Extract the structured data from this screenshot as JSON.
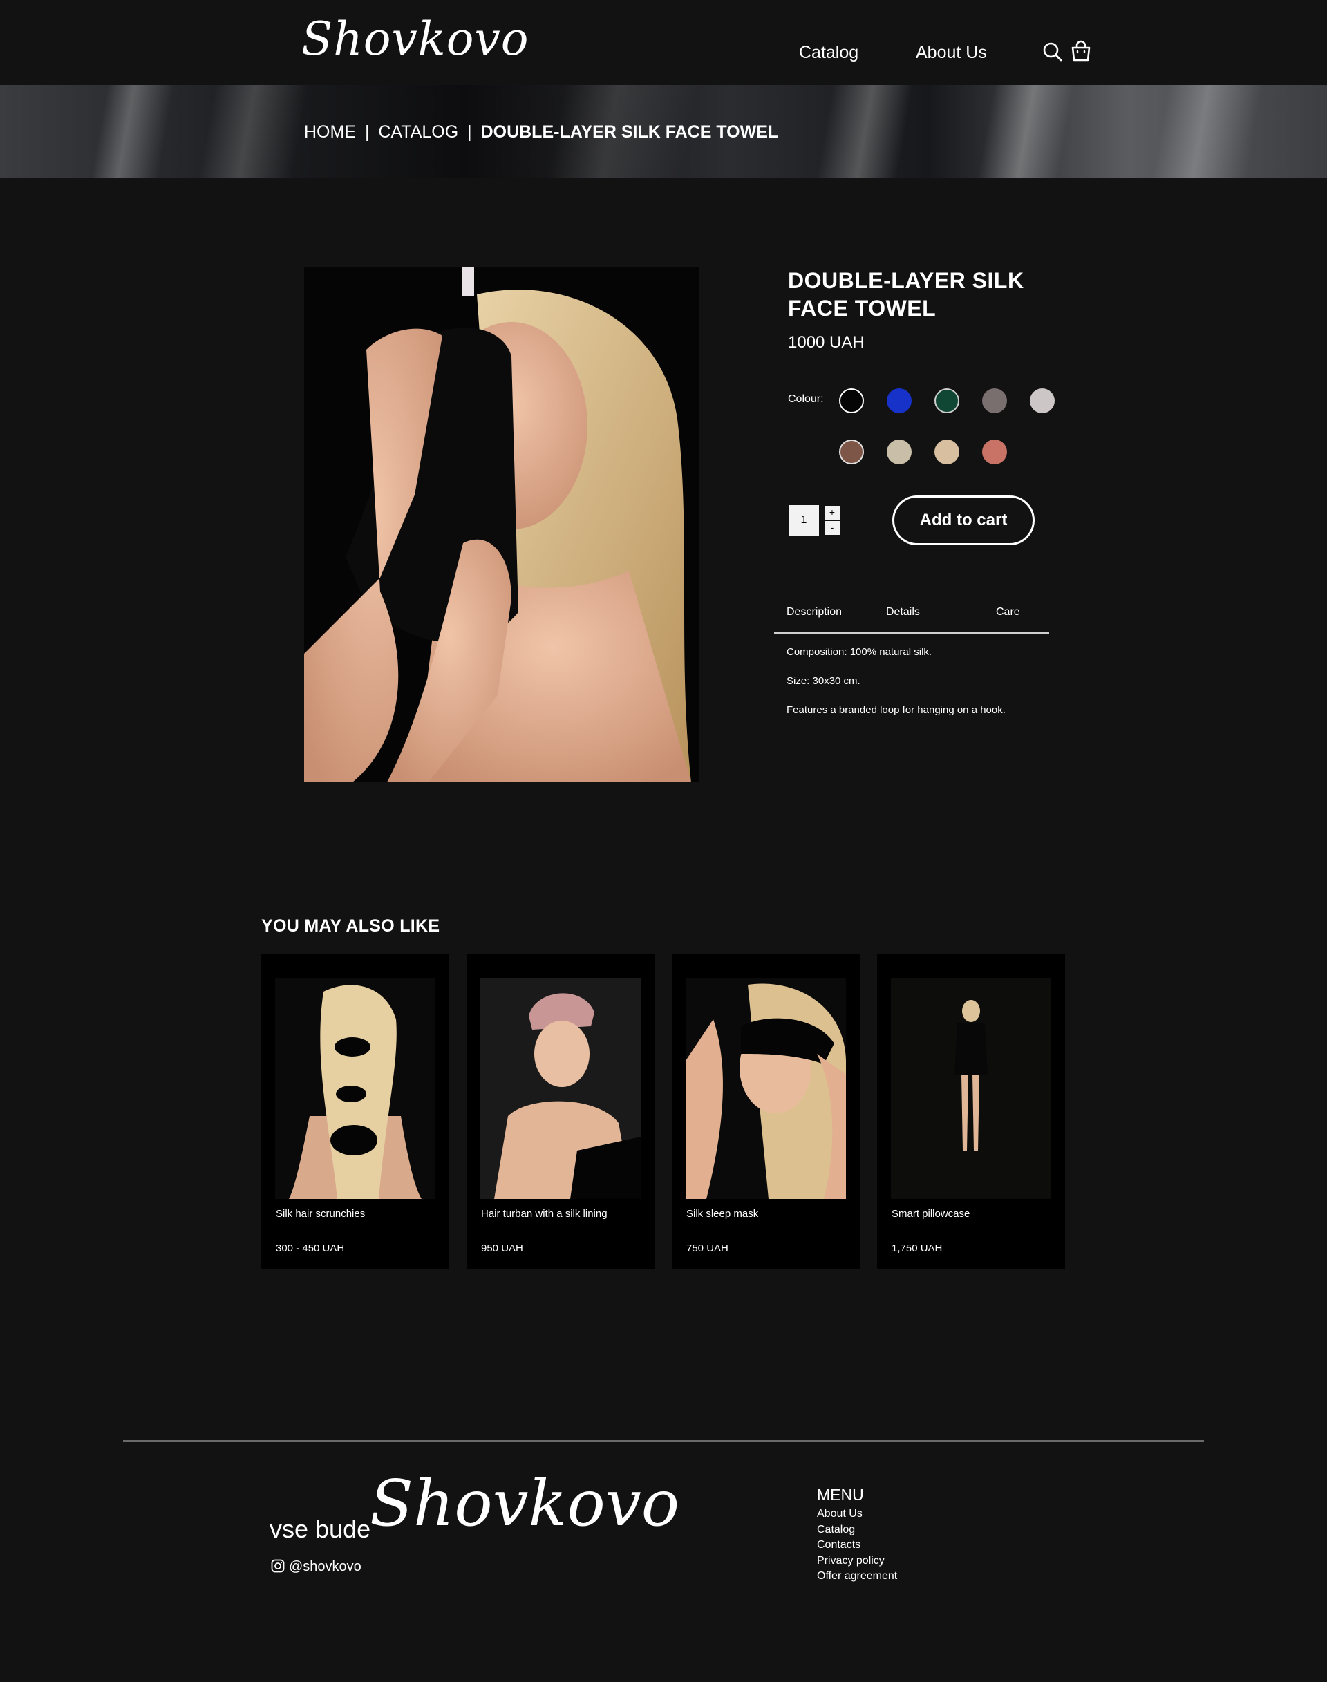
{
  "header": {
    "logo_text": "Shovkovo",
    "nav": {
      "catalog": "Catalog",
      "about": "About Us"
    },
    "icons": {
      "search": "search-icon",
      "cart": "shopping-bag-icon"
    }
  },
  "breadcrumb": {
    "home": "HOME",
    "separator": "|",
    "catalog": "CATALOG",
    "current": "DOUBLE-LAYER SILK FACE TOWEL"
  },
  "product": {
    "title_line1": "DOUBLE-LAYER SILK",
    "title_line2": "FACE TOWEL",
    "price": "1000 UAH",
    "colour_label": "Colour:",
    "colours": [
      "#050505",
      "#1632c8",
      "#0f4634",
      "#7a6f6f",
      "#cdc6c7",
      "#7d5648",
      "#c9bfa9",
      "#d7bf9f",
      "#c87365"
    ],
    "quantity": "1",
    "qty_plus": "+",
    "qty_minus": "-",
    "add_to_cart": "Add to cart",
    "tabs": {
      "description": "Description",
      "details": "Details",
      "care": "Care"
    },
    "description": [
      "Composition: 100% natural silk.",
      "Size: 30x30 cm.",
      "Features a branded loop for hanging on a hook."
    ]
  },
  "related": {
    "title": "YOU MAY ALSO LIKE",
    "items": [
      {
        "name": "Silk hair scrunchies",
        "price": "300 - 450 UAH"
      },
      {
        "name": "Hair turban with a silk lining",
        "price": "950 UAH"
      },
      {
        "name": "Silk sleep mask",
        "price": "750 UAH"
      },
      {
        "name": "Smart pillowcase",
        "price": "1,750 UAH"
      }
    ]
  },
  "footer": {
    "slogan": "vse bude",
    "logo_text": "Shovkovo",
    "instagram": "@shovkovo",
    "menu_title": "MENU",
    "menu_items": [
      "About Us",
      "Catalog",
      "Contacts",
      "Privacy policy",
      "Offer agreement"
    ]
  }
}
